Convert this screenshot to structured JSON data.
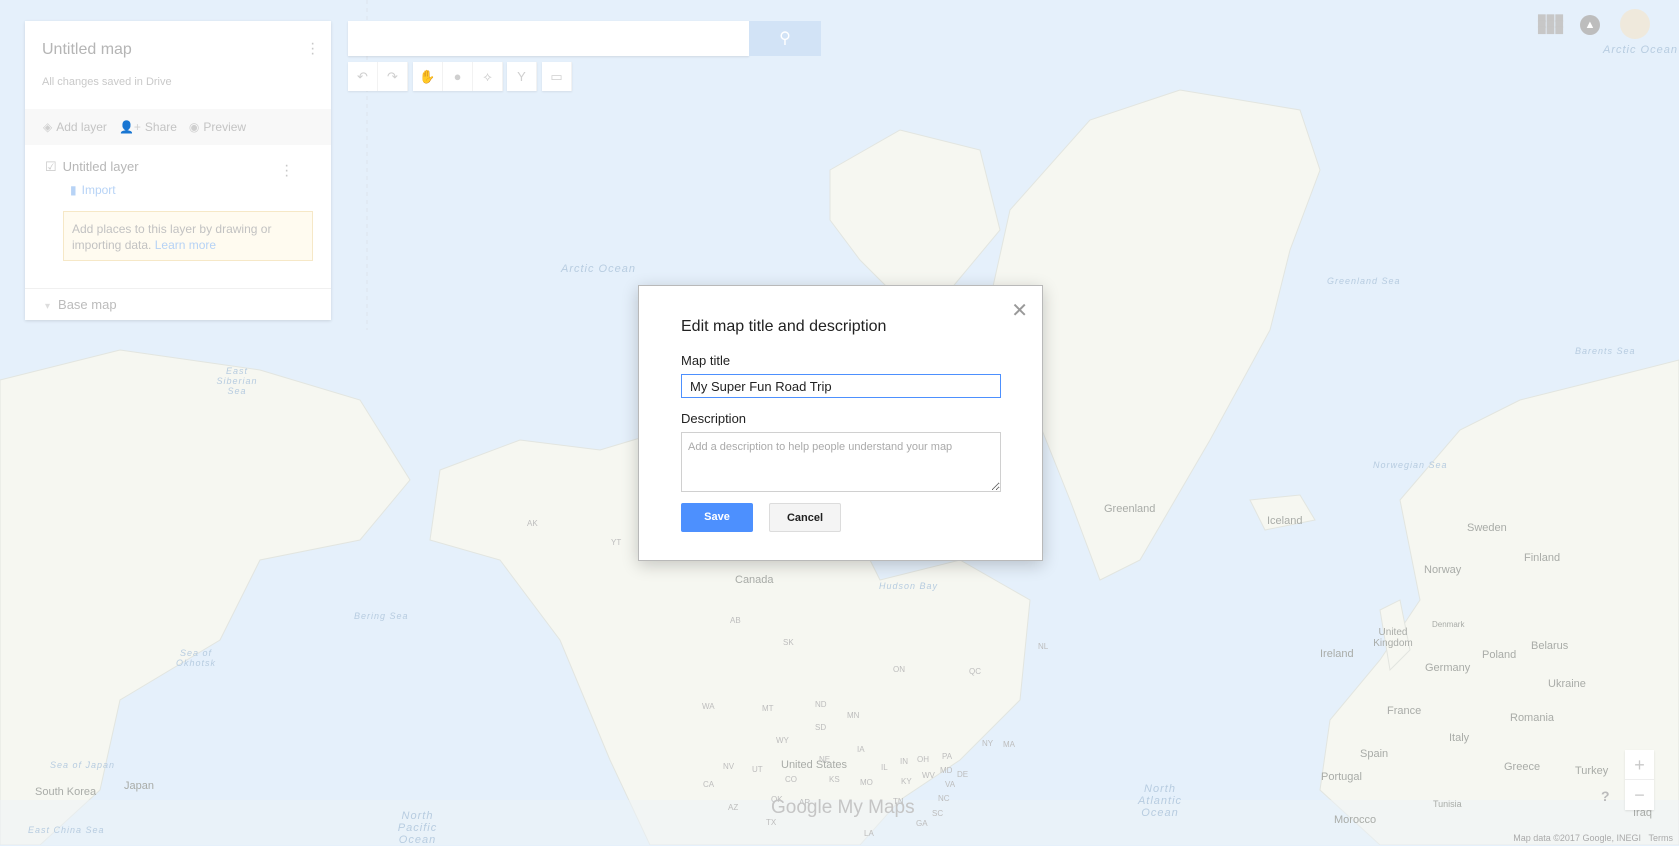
{
  "panel": {
    "title": "Untitled map",
    "subtitle": "All changes saved in Drive",
    "add_layer": "Add layer",
    "share": "Share",
    "preview": "Preview",
    "layer_name": "Untitled layer",
    "import": "Import",
    "tip_text": "Add places to this layer by drawing or importing data.",
    "tip_link": "Learn more",
    "base_map": "Base map"
  },
  "search": {
    "placeholder": ""
  },
  "dialog": {
    "title": "Edit map title and description",
    "map_title_label": "Map title",
    "map_title_value": "My Super Fun Road Trip",
    "description_label": "Description",
    "description_placeholder": "Add a description to help people understand your map",
    "save": "Save",
    "cancel": "Cancel"
  },
  "map": {
    "seas": [
      "Arctic Ocean",
      "Arctic Ocean",
      "Greenland Sea",
      "Barents Sea",
      "Norwegian Sea",
      "Hudson Bay",
      "Bering Sea",
      "Sea of Okhotsk",
      "East Siberian Sea",
      "Sea of Japan",
      "East China Sea",
      "North Pacific Ocean",
      "North Atlantic Ocean"
    ],
    "countries": [
      "Greenland",
      "Iceland",
      "Sweden",
      "Finland",
      "Norway",
      "Canada",
      "Denmark",
      "United Kingdom",
      "Ireland",
      "Poland",
      "Belarus",
      "Germany",
      "Ukraine",
      "France",
      "Romania",
      "Italy",
      "Spain",
      "Portugal",
      "Greece",
      "Turkey",
      "Morocco",
      "Tunisia",
      "Iraq",
      "United States",
      "South Korea",
      "Japan"
    ],
    "states": [
      "AK",
      "YT",
      "AB",
      "SK",
      "ON",
      "QC",
      "NL",
      "WA",
      "MT",
      "ND",
      "MN",
      "NV",
      "UT",
      "CO",
      "KS",
      "MO",
      "IL",
      "IN",
      "OH",
      "PA",
      "NY",
      "MA",
      "CA",
      "AZ",
      "TX",
      "OK",
      "AR",
      "KY",
      "WV",
      "VA",
      "MD",
      "DE",
      "TN",
      "NC",
      "SC",
      "GA",
      "LA",
      "NE",
      "IA",
      "WY",
      "SD"
    ]
  },
  "logo": "Google My Maps",
  "footer": {
    "attribution": "Map data ©2017 Google, INEGI",
    "terms": "Terms"
  },
  "colors": {
    "accent": "#4d90fe",
    "water": "#e5f0fb",
    "land": "#f7f7f2"
  }
}
